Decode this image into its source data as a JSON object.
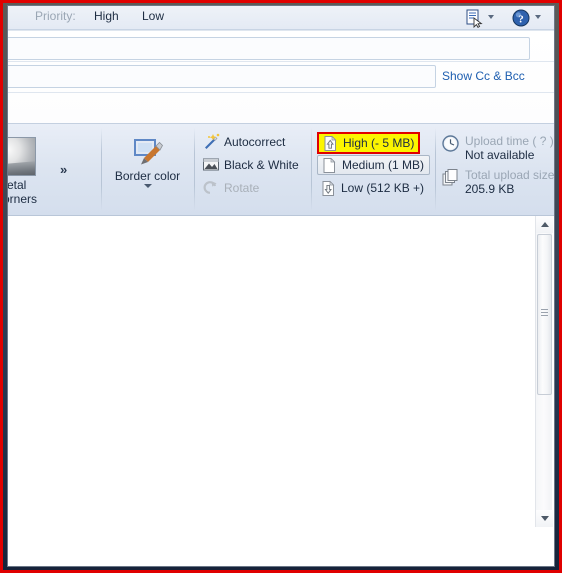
{
  "window": {
    "frame_color": "#2a3a55",
    "annotation_border_color": "#e00000"
  },
  "priority_bar": {
    "label": "Priority:",
    "options": [
      "High",
      "Low"
    ],
    "icons": [
      "signature-icon",
      "help-icon"
    ]
  },
  "header": {
    "to_value": "",
    "to_placeholder": "",
    "subject_value": "",
    "subject_placeholder": "",
    "show_cc_bcc_link": "Show Cc & Bcc"
  },
  "ribbon": {
    "groups": [
      {
        "name": "gallery",
        "thumbnail_caption": "Metal corners",
        "more_label": "»"
      },
      {
        "name": "border-color",
        "button_label": "Border color",
        "has_dropdown": true
      },
      {
        "name": "tools",
        "items": [
          {
            "label": "Autocorrect",
            "icon": "magic-wand-icon",
            "disabled": false
          },
          {
            "label": "Black & White",
            "icon": "grayscale-image-icon",
            "disabled": false
          },
          {
            "label": "Rotate",
            "icon": "rotate-icon",
            "disabled": true
          }
        ]
      },
      {
        "name": "upload-quality",
        "highlight_color": "#fcf500",
        "highlight_border_color": "#e00000",
        "items": [
          {
            "label": "High (- 5 MB)",
            "icon": "page-up-arrow-icon",
            "state": "highlighted"
          },
          {
            "label": "Medium (1 MB)",
            "icon": "page-icon",
            "state": "selected"
          },
          {
            "label": "Low (512 KB +)",
            "icon": "page-down-arrow-icon",
            "state": "normal"
          }
        ]
      },
      {
        "name": "upload-info",
        "rows": [
          {
            "icon": "clock-icon",
            "key": "Upload time ( ? )",
            "value": "Not available"
          },
          {
            "icon": "stacked-pages-icon",
            "key": "Total upload size",
            "value": "205.9 KB"
          }
        ]
      }
    ]
  },
  "scrollbar": {
    "up_label": "▲",
    "down_label": "▼",
    "thumb_position_pct": 6
  }
}
